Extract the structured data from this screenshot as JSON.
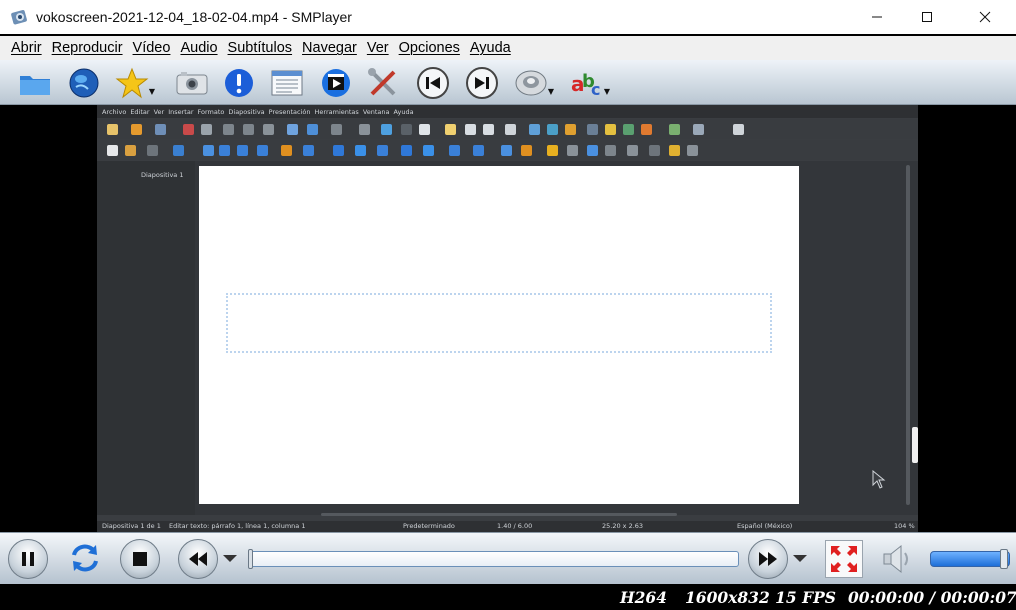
{
  "window": {
    "title": "vokoscreen-2021-12-04_18-02-04.mp4 - SMPlayer"
  },
  "menu": [
    {
      "label": "Abrir"
    },
    {
      "label": "Reproducir"
    },
    {
      "label": "Vídeo"
    },
    {
      "label": "Audio"
    },
    {
      "label": "Subtítulos"
    },
    {
      "label": "Navegar"
    },
    {
      "label": "Ver"
    },
    {
      "label": "Opciones"
    },
    {
      "label": "Ayuda"
    }
  ],
  "toolbar": {
    "icons": [
      "folder-icon",
      "globe-icon",
      "favorites-star-icon",
      "screenshot-camera-icon",
      "info-icon",
      "playlist-icon",
      "video-filters-icon",
      "preferences-tools-icon",
      "previous-icon",
      "next-icon",
      "audio-track-icon",
      "subtitle-track-icon"
    ]
  },
  "video_content": {
    "lo_menu": [
      "Archivo",
      "Editar",
      "Ver",
      "Insertar",
      "Formato",
      "Diapositiva",
      "Presentación",
      "Herramientas",
      "Ventana",
      "Ayuda"
    ],
    "slide_pane_label": "Diapositiva 1",
    "status": {
      "slide": "Diapositiva 1 de 1",
      "edit": "Editar texto: párrafo 1, línea 1, columna 1",
      "layout": "Predeterminado",
      "position": "1.40 / 6.00",
      "size": "25.20 x 2.63",
      "language": "Español (México)",
      "zoom": "104 %"
    }
  },
  "controls": {
    "play_state": "paused",
    "seek_fraction": 0.0,
    "volume_fraction": 0.96,
    "icons": [
      "pause-icon",
      "repeat-icon",
      "stop-icon",
      "rewind-icon",
      "forward-icon",
      "fullscreen-icon",
      "speaker-icon"
    ]
  },
  "status": {
    "codec": "H264",
    "resolution": "1600x832 15 FPS",
    "time": "00:00:00 / 00:00:07"
  },
  "colors": {
    "accent": "#1e6fd8",
    "seek_border": "#6a8fb8"
  }
}
